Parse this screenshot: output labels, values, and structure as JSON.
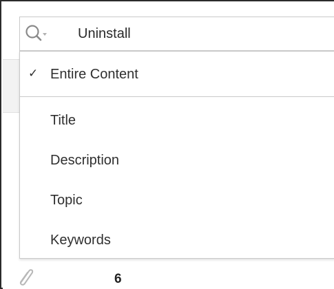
{
  "search": {
    "value": "Uninstall",
    "icon": "search-dropdown-icon"
  },
  "menu": {
    "items": [
      {
        "label": "Entire Content",
        "checked": true
      },
      {
        "label": "Title",
        "checked": false
      },
      {
        "label": "Description",
        "checked": false
      },
      {
        "label": "Topic",
        "checked": false
      },
      {
        "label": "Keywords",
        "checked": false
      }
    ],
    "check_glyph": "✓"
  },
  "footer_row": {
    "attachment_icon": "paperclip-icon",
    "count": "6"
  }
}
